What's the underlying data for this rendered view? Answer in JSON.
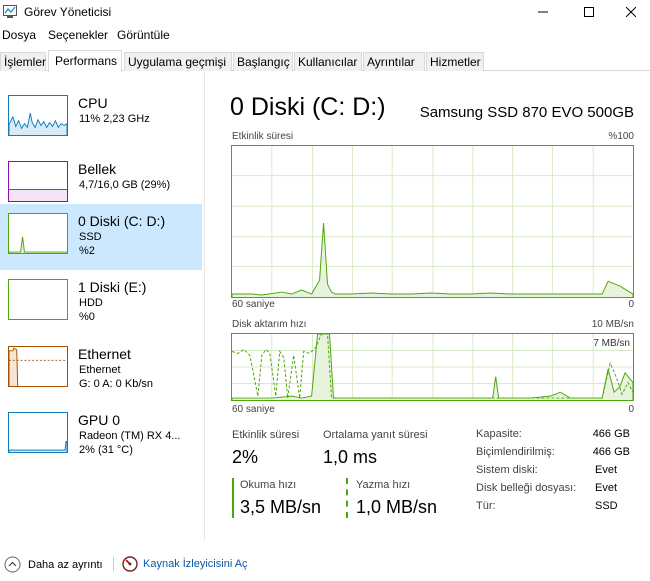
{
  "window": {
    "title": "Görev Yöneticisi"
  },
  "menu": [
    "Dosya",
    "Seçenekler",
    "Görüntüle"
  ],
  "tabs": [
    "İşlemler",
    "Performans",
    "Uygulama geçmişi",
    "Başlangıç",
    "Kullanıcılar",
    "Ayrıntılar",
    "Hizmetler"
  ],
  "active_tab": "Performans",
  "resources": [
    {
      "name": "CPU",
      "line1": "11% 2,23 GHz",
      "line2": ""
    },
    {
      "name": "Bellek",
      "line1": "4,7/16,0 GB (29%)",
      "line2": ""
    },
    {
      "name": "0 Diski (C: D:)",
      "line1": "SSD",
      "line2": "%2"
    },
    {
      "name": "1 Diski (E:)",
      "line1": "HDD",
      "line2": "%0"
    },
    {
      "name": "Ethernet",
      "line1": "Ethernet",
      "line2": "G: 0 A: 0 Kb/sn"
    },
    {
      "name": "GPU 0",
      "line1": "Radeon (TM) RX 4...",
      "line2": "2% (31 °C)"
    }
  ],
  "colors": {
    "cpu": "#117dbb",
    "memory": "#8b12ae",
    "disk": "#4da60c",
    "ethernet": "#a74f01",
    "gpu": "#117dbb",
    "selected": "#cce8ff"
  },
  "detail": {
    "title": "0 Diski (C: D:)",
    "model": "Samsung SSD 870 EVO 500GB",
    "graph1": {
      "label": "Etkinlik süresi",
      "max": "%100",
      "x_left": "60 saniye",
      "x_right": "0"
    },
    "graph2": {
      "label": "Disk aktarım hızı",
      "max": "10 MB/sn",
      "inner_label": "7 MB/sn",
      "x_left": "60 saniye",
      "x_right": "0"
    },
    "stats": {
      "active_time_label": "Etkinlik süresi",
      "active_time": "2%",
      "avg_response_label": "Ortalama yanıt süresi",
      "avg_response": "1,0 ms",
      "read_label": "Okuma hızı",
      "read": "3,5 MB/sn",
      "write_label": "Yazma hızı",
      "write": "1,0 MB/sn"
    },
    "props": [
      {
        "k": "Kapasite:",
        "v": "466 GB"
      },
      {
        "k": "Biçimlendirilmiş:",
        "v": "466 GB"
      },
      {
        "k": "Sistem diski:",
        "v": "Evet"
      },
      {
        "k": "Disk belleği dosyası:",
        "v": "Evet"
      },
      {
        "k": "Tür:",
        "v": "SSD"
      }
    ]
  },
  "footer": {
    "less_details": "Daha az ayrıntı",
    "resource_monitor": "Kaynak İzleyicisini Aç"
  }
}
